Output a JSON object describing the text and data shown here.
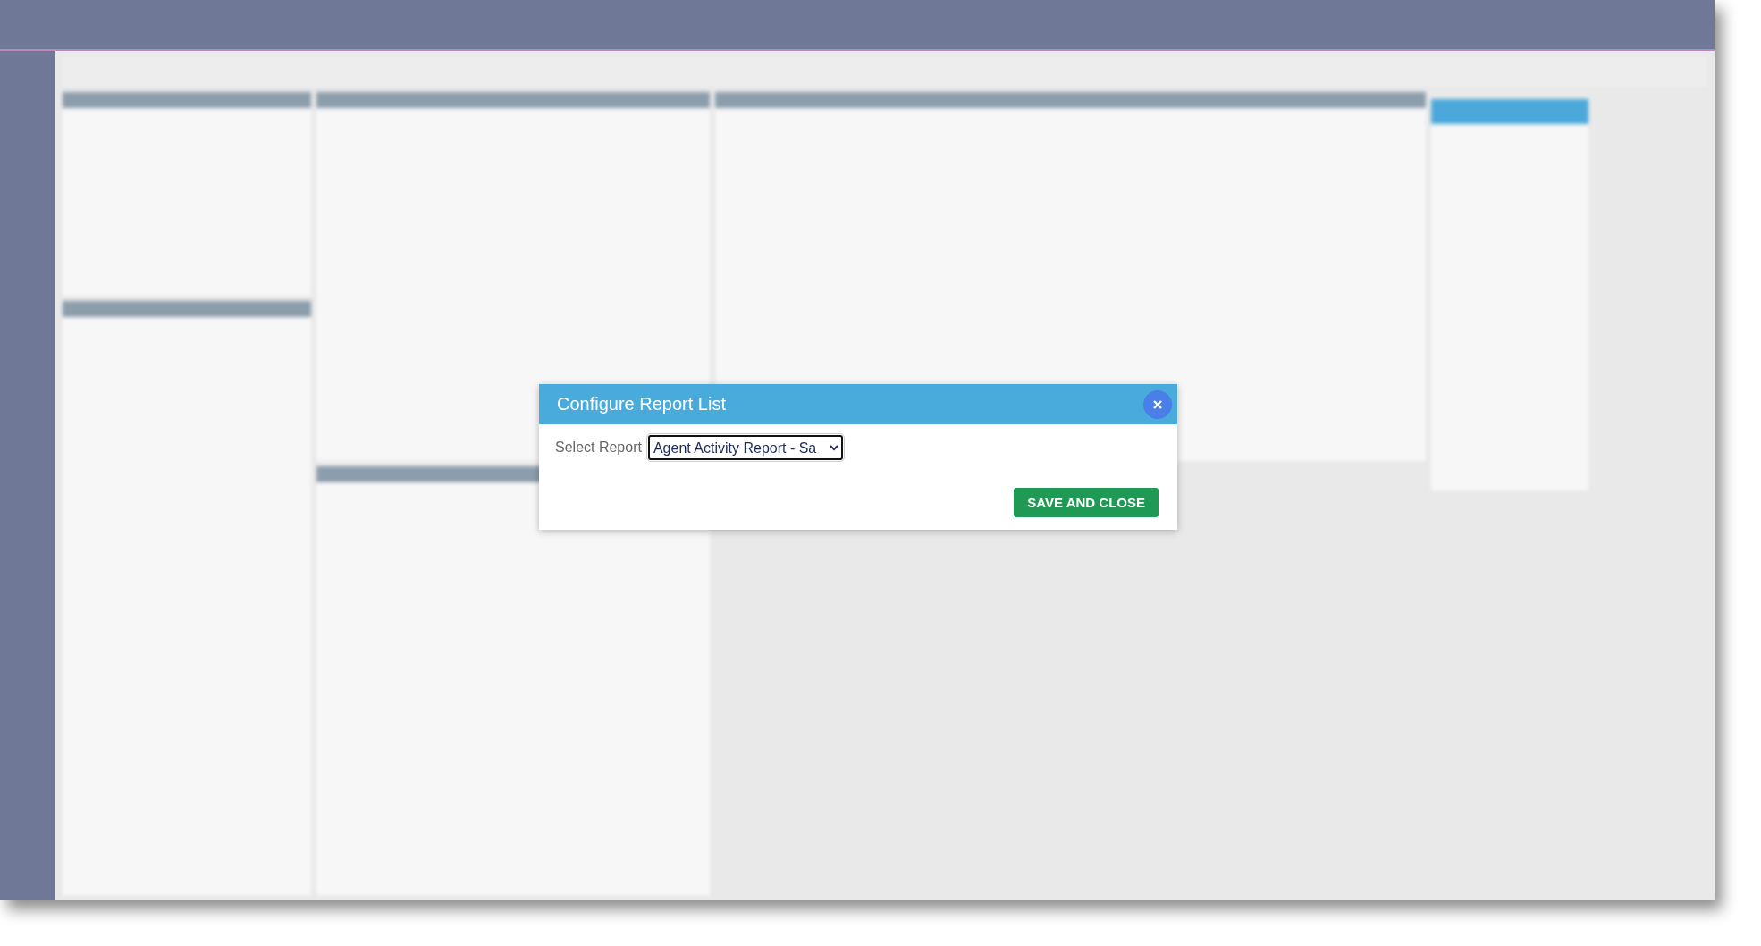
{
  "dialog": {
    "title": "Configure Report List",
    "field": {
      "label": "Select Report",
      "value": "Agent Activity Report - Sa"
    },
    "buttons": [
      {
        "label": "SAVE AND CLOSE",
        "kind": "primary"
      }
    ]
  }
}
